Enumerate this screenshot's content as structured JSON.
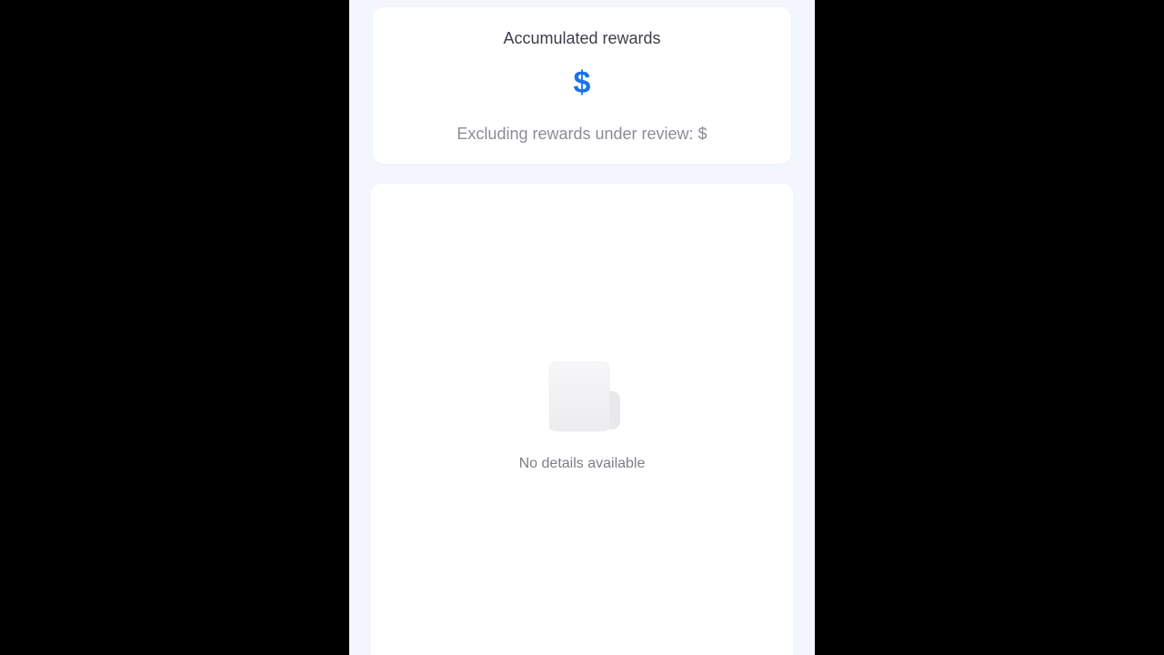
{
  "rewards": {
    "title": "Accumulated rewards",
    "amount": "$",
    "excluding_label": "Excluding rewards under review: $"
  },
  "details": {
    "empty_icon": "empty-document-icon",
    "empty_message": "No details available"
  },
  "colors": {
    "accent": "#1a73e8",
    "page_bg": "#f3f7fd",
    "card_bg": "#ffffff",
    "letterbox": "#000000"
  }
}
